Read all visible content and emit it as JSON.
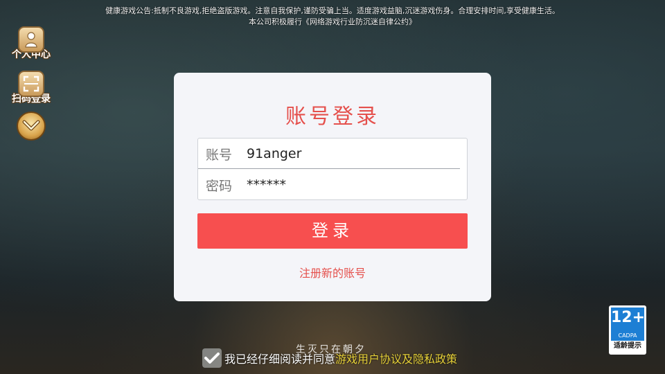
{
  "notice": {
    "line1": "健康游戏公告:抵制不良游戏,拒绝盗版游戏。注意自我保护,谨防受骗上当。适度游戏益脑,沉迷游戏伤身。合理安排时间,享受健康生活。",
    "line2": "本公司积极履行《网络游戏行业防沉迷自律公约》"
  },
  "sidebar": {
    "items": [
      {
        "label": "个人中心",
        "icon": "person-icon"
      },
      {
        "label": "扫码登录",
        "icon": "qr-scan-icon"
      },
      {
        "label": "",
        "icon": "chevron-down-icon"
      }
    ]
  },
  "login": {
    "title": "账号登录",
    "account_label": "账号",
    "account_value": "91anger",
    "password_label": "密码",
    "password_value": "******",
    "button_label": "登录",
    "register_link": "注册新的账号"
  },
  "age_badge": {
    "number": "12+",
    "org": "CADPA",
    "caption": "适龄提示"
  },
  "background_text": "生灭只在朝夕",
  "agreement": {
    "checked": true,
    "text": "我已经仔细阅读并同意",
    "link": "游戏用户协议及隐私政策"
  },
  "colors": {
    "accent_red": "#f74f4f",
    "title_red": "#e5504c",
    "link_yellow": "#e8d23a",
    "badge_blue": "#1d7fd4"
  }
}
